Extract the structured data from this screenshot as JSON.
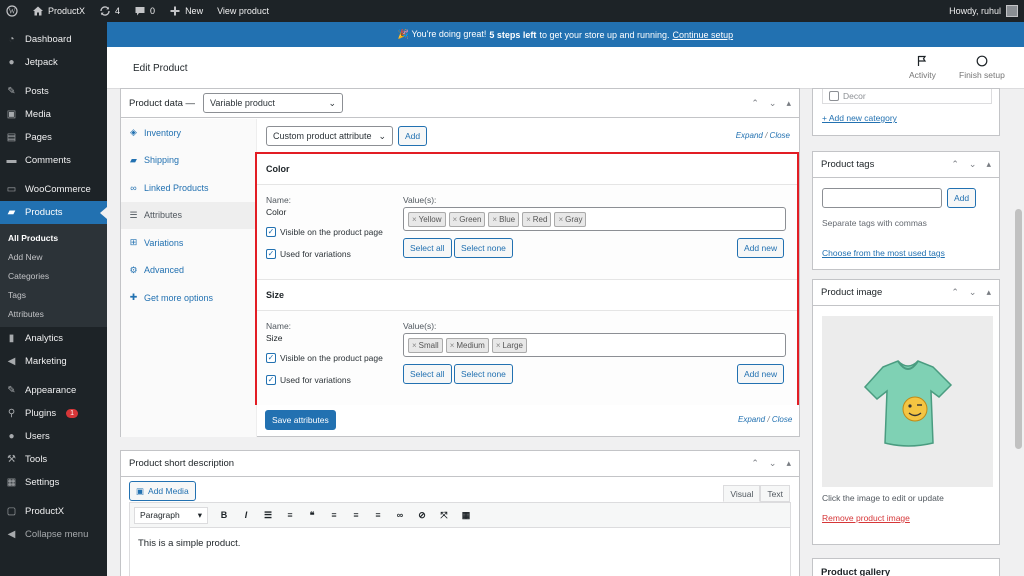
{
  "adminbar": {
    "site_name": "ProductX",
    "updates_count": "4",
    "comments_count": "0",
    "new_label": "New",
    "view_label": "View product",
    "howdy": "Howdy, ruhul"
  },
  "sidebar": {
    "items": [
      {
        "label": "Dashboard",
        "icon": "dashboard-icon"
      },
      {
        "label": "Jetpack",
        "icon": "jetpack-icon"
      },
      {
        "label": "Posts",
        "icon": "pin-icon"
      },
      {
        "label": "Media",
        "icon": "media-icon"
      },
      {
        "label": "Pages",
        "icon": "pages-icon"
      },
      {
        "label": "Comments",
        "icon": "comments-icon"
      },
      {
        "label": "WooCommerce",
        "icon": "woo-icon"
      },
      {
        "label": "Products",
        "icon": "products-icon"
      }
    ],
    "products_sub": [
      "All Products",
      "Add New",
      "Categories",
      "Tags",
      "Attributes"
    ],
    "items2": [
      {
        "label": "Analytics",
        "icon": "analytics-icon"
      },
      {
        "label": "Marketing",
        "icon": "marketing-icon"
      },
      {
        "label": "Appearance",
        "icon": "appearance-icon"
      },
      {
        "label": "Plugins",
        "icon": "plugins-icon",
        "badge": "1"
      },
      {
        "label": "Users",
        "icon": "users-icon"
      },
      {
        "label": "Tools",
        "icon": "tools-icon"
      },
      {
        "label": "Settings",
        "icon": "settings-icon"
      },
      {
        "label": "ProductX",
        "icon": "productx-icon"
      },
      {
        "label": "Collapse menu",
        "icon": "collapse-icon"
      }
    ]
  },
  "notice": {
    "text_pre": "🎉 You're doing great! ",
    "text_bold": "5 steps left",
    "text_mid": " to get your store up and running. ",
    "link": "Continue setup"
  },
  "header": {
    "title": "Edit Product",
    "activity": "Activity",
    "finish_setup": "Finish setup"
  },
  "product_data": {
    "label": "Product data —",
    "type": "Variable product",
    "tabs": [
      "Inventory",
      "Shipping",
      "Linked Products",
      "Attributes",
      "Variations",
      "Advanced",
      "Get more options"
    ],
    "attr_select": "Custom product attribute",
    "add_btn": "Add",
    "expand": "Expand",
    "close": "Close",
    "slash": "/",
    "attributes": [
      {
        "title": "Color",
        "name_label": "Name:",
        "name": "Color",
        "values_label": "Value(s):",
        "values": [
          "Yellow",
          "Green",
          "Blue",
          "Red",
          "Gray"
        ],
        "visible_label": "Visible on the product page",
        "variations_label": "Used for variations"
      },
      {
        "title": "Size",
        "name_label": "Name:",
        "name": "Size",
        "values_label": "Value(s):",
        "values": [
          "Small",
          "Medium",
          "Large"
        ],
        "visible_label": "Visible on the product page",
        "variations_label": "Used for variations"
      }
    ],
    "select_all": "Select all",
    "select_none": "Select none",
    "add_new": "Add new",
    "save_attributes": "Save attributes",
    "chip_x": "×"
  },
  "short_desc": {
    "title": "Product short description",
    "add_media": "Add Media",
    "visual": "Visual",
    "text": "Text",
    "format": "Paragraph",
    "content": "This is a simple product."
  },
  "right": {
    "category_item": "Decor",
    "add_category": "+ Add new category",
    "tags_title": "Product tags",
    "tags_add": "Add",
    "tags_help": "Separate tags with commas",
    "tags_choose": "Choose from the most used tags",
    "image_title": "Product image",
    "image_help": "Click the image to edit or update",
    "image_remove": "Remove product image",
    "gallery_title": "Product gallery"
  },
  "colors": {
    "accent": "#2271b1",
    "adminbar": "#1d2327",
    "highlight_frame": "#e21d24"
  }
}
